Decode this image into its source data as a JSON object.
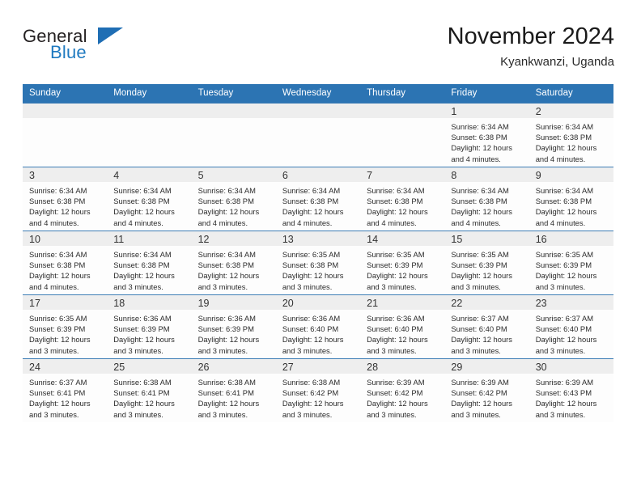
{
  "brand": {
    "logo_primary": "General",
    "logo_secondary": "Blue",
    "logo_triangle_icon": "triangle-icon",
    "accent_color": "#2c74b3",
    "logo_blue_color": "#1f7ac0",
    "logo_dark_color": "#231f20"
  },
  "header": {
    "title": "November 2024",
    "subtitle": "Kyankwanzi, Uganda"
  },
  "calendar": {
    "weekday_headers": [
      "Sunday",
      "Monday",
      "Tuesday",
      "Wednesday",
      "Thursday",
      "Friday",
      "Saturday"
    ],
    "labels": {
      "sunrise": "Sunrise:",
      "sunset": "Sunset:",
      "daylight": "Daylight:"
    },
    "weeks": [
      [
        {
          "day": "",
          "sunrise": "",
          "sunset": "",
          "daylight_line1": "",
          "daylight_line2": ""
        },
        {
          "day": "",
          "sunrise": "",
          "sunset": "",
          "daylight_line1": "",
          "daylight_line2": ""
        },
        {
          "day": "",
          "sunrise": "",
          "sunset": "",
          "daylight_line1": "",
          "daylight_line2": ""
        },
        {
          "day": "",
          "sunrise": "",
          "sunset": "",
          "daylight_line1": "",
          "daylight_line2": ""
        },
        {
          "day": "",
          "sunrise": "",
          "sunset": "",
          "daylight_line1": "",
          "daylight_line2": ""
        },
        {
          "day": "1",
          "sunrise": "Sunrise: 6:34 AM",
          "sunset": "Sunset: 6:38 PM",
          "daylight_line1": "Daylight: 12 hours",
          "daylight_line2": "and 4 minutes."
        },
        {
          "day": "2",
          "sunrise": "Sunrise: 6:34 AM",
          "sunset": "Sunset: 6:38 PM",
          "daylight_line1": "Daylight: 12 hours",
          "daylight_line2": "and 4 minutes."
        }
      ],
      [
        {
          "day": "3",
          "sunrise": "Sunrise: 6:34 AM",
          "sunset": "Sunset: 6:38 PM",
          "daylight_line1": "Daylight: 12 hours",
          "daylight_line2": "and 4 minutes."
        },
        {
          "day": "4",
          "sunrise": "Sunrise: 6:34 AM",
          "sunset": "Sunset: 6:38 PM",
          "daylight_line1": "Daylight: 12 hours",
          "daylight_line2": "and 4 minutes."
        },
        {
          "day": "5",
          "sunrise": "Sunrise: 6:34 AM",
          "sunset": "Sunset: 6:38 PM",
          "daylight_line1": "Daylight: 12 hours",
          "daylight_line2": "and 4 minutes."
        },
        {
          "day": "6",
          "sunrise": "Sunrise: 6:34 AM",
          "sunset": "Sunset: 6:38 PM",
          "daylight_line1": "Daylight: 12 hours",
          "daylight_line2": "and 4 minutes."
        },
        {
          "day": "7",
          "sunrise": "Sunrise: 6:34 AM",
          "sunset": "Sunset: 6:38 PM",
          "daylight_line1": "Daylight: 12 hours",
          "daylight_line2": "and 4 minutes."
        },
        {
          "day": "8",
          "sunrise": "Sunrise: 6:34 AM",
          "sunset": "Sunset: 6:38 PM",
          "daylight_line1": "Daylight: 12 hours",
          "daylight_line2": "and 4 minutes."
        },
        {
          "day": "9",
          "sunrise": "Sunrise: 6:34 AM",
          "sunset": "Sunset: 6:38 PM",
          "daylight_line1": "Daylight: 12 hours",
          "daylight_line2": "and 4 minutes."
        }
      ],
      [
        {
          "day": "10",
          "sunrise": "Sunrise: 6:34 AM",
          "sunset": "Sunset: 6:38 PM",
          "daylight_line1": "Daylight: 12 hours",
          "daylight_line2": "and 4 minutes."
        },
        {
          "day": "11",
          "sunrise": "Sunrise: 6:34 AM",
          "sunset": "Sunset: 6:38 PM",
          "daylight_line1": "Daylight: 12 hours",
          "daylight_line2": "and 3 minutes."
        },
        {
          "day": "12",
          "sunrise": "Sunrise: 6:34 AM",
          "sunset": "Sunset: 6:38 PM",
          "daylight_line1": "Daylight: 12 hours",
          "daylight_line2": "and 3 minutes."
        },
        {
          "day": "13",
          "sunrise": "Sunrise: 6:35 AM",
          "sunset": "Sunset: 6:38 PM",
          "daylight_line1": "Daylight: 12 hours",
          "daylight_line2": "and 3 minutes."
        },
        {
          "day": "14",
          "sunrise": "Sunrise: 6:35 AM",
          "sunset": "Sunset: 6:39 PM",
          "daylight_line1": "Daylight: 12 hours",
          "daylight_line2": "and 3 minutes."
        },
        {
          "day": "15",
          "sunrise": "Sunrise: 6:35 AM",
          "sunset": "Sunset: 6:39 PM",
          "daylight_line1": "Daylight: 12 hours",
          "daylight_line2": "and 3 minutes."
        },
        {
          "day": "16",
          "sunrise": "Sunrise: 6:35 AM",
          "sunset": "Sunset: 6:39 PM",
          "daylight_line1": "Daylight: 12 hours",
          "daylight_line2": "and 3 minutes."
        }
      ],
      [
        {
          "day": "17",
          "sunrise": "Sunrise: 6:35 AM",
          "sunset": "Sunset: 6:39 PM",
          "daylight_line1": "Daylight: 12 hours",
          "daylight_line2": "and 3 minutes."
        },
        {
          "day": "18",
          "sunrise": "Sunrise: 6:36 AM",
          "sunset": "Sunset: 6:39 PM",
          "daylight_line1": "Daylight: 12 hours",
          "daylight_line2": "and 3 minutes."
        },
        {
          "day": "19",
          "sunrise": "Sunrise: 6:36 AM",
          "sunset": "Sunset: 6:39 PM",
          "daylight_line1": "Daylight: 12 hours",
          "daylight_line2": "and 3 minutes."
        },
        {
          "day": "20",
          "sunrise": "Sunrise: 6:36 AM",
          "sunset": "Sunset: 6:40 PM",
          "daylight_line1": "Daylight: 12 hours",
          "daylight_line2": "and 3 minutes."
        },
        {
          "day": "21",
          "sunrise": "Sunrise: 6:36 AM",
          "sunset": "Sunset: 6:40 PM",
          "daylight_line1": "Daylight: 12 hours",
          "daylight_line2": "and 3 minutes."
        },
        {
          "day": "22",
          "sunrise": "Sunrise: 6:37 AM",
          "sunset": "Sunset: 6:40 PM",
          "daylight_line1": "Daylight: 12 hours",
          "daylight_line2": "and 3 minutes."
        },
        {
          "day": "23",
          "sunrise": "Sunrise: 6:37 AM",
          "sunset": "Sunset: 6:40 PM",
          "daylight_line1": "Daylight: 12 hours",
          "daylight_line2": "and 3 minutes."
        }
      ],
      [
        {
          "day": "24",
          "sunrise": "Sunrise: 6:37 AM",
          "sunset": "Sunset: 6:41 PM",
          "daylight_line1": "Daylight: 12 hours",
          "daylight_line2": "and 3 minutes."
        },
        {
          "day": "25",
          "sunrise": "Sunrise: 6:38 AM",
          "sunset": "Sunset: 6:41 PM",
          "daylight_line1": "Daylight: 12 hours",
          "daylight_line2": "and 3 minutes."
        },
        {
          "day": "26",
          "sunrise": "Sunrise: 6:38 AM",
          "sunset": "Sunset: 6:41 PM",
          "daylight_line1": "Daylight: 12 hours",
          "daylight_line2": "and 3 minutes."
        },
        {
          "day": "27",
          "sunrise": "Sunrise: 6:38 AM",
          "sunset": "Sunset: 6:42 PM",
          "daylight_line1": "Daylight: 12 hours",
          "daylight_line2": "and 3 minutes."
        },
        {
          "day": "28",
          "sunrise": "Sunrise: 6:39 AM",
          "sunset": "Sunset: 6:42 PM",
          "daylight_line1": "Daylight: 12 hours",
          "daylight_line2": "and 3 minutes."
        },
        {
          "day": "29",
          "sunrise": "Sunrise: 6:39 AM",
          "sunset": "Sunset: 6:42 PM",
          "daylight_line1": "Daylight: 12 hours",
          "daylight_line2": "and 3 minutes."
        },
        {
          "day": "30",
          "sunrise": "Sunrise: 6:39 AM",
          "sunset": "Sunset: 6:43 PM",
          "daylight_line1": "Daylight: 12 hours",
          "daylight_line2": "and 3 minutes."
        }
      ]
    ]
  }
}
